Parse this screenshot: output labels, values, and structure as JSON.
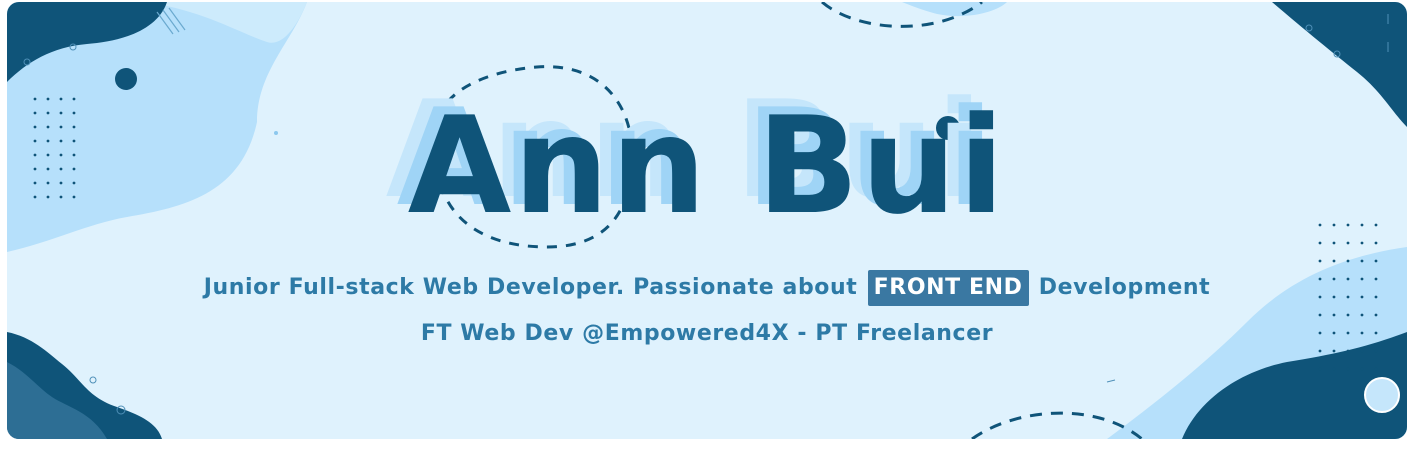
{
  "banner": {
    "name": "Ann Bui",
    "tagline": {
      "before": "Junior Full-stack Web Developer. Passionate about",
      "highlight": "FRONT END",
      "after": "Development"
    },
    "subline": "FT Web Dev @Empowered4X - PT Freelancer"
  },
  "colors": {
    "background": "#dff2fd",
    "navy": "#0f5479",
    "light_blue": "#b6e0fb",
    "text_blue": "#2d7aa6",
    "highlight_bg": "#3a78a2"
  }
}
